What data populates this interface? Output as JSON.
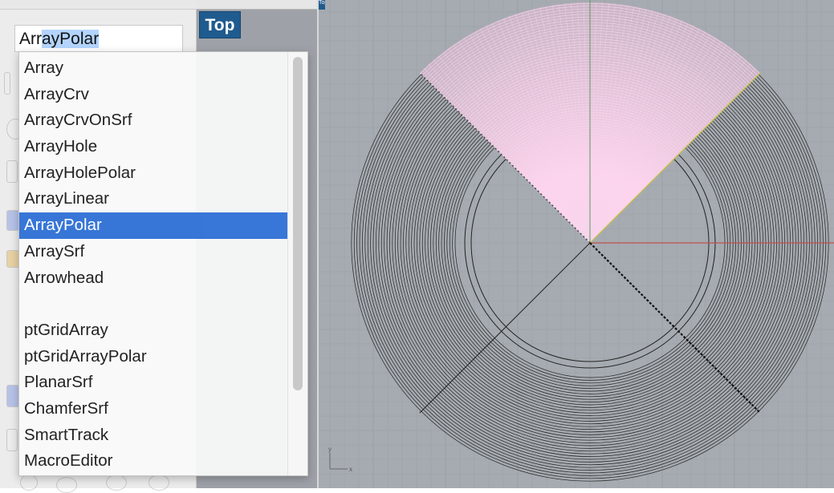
{
  "command_input": {
    "typed": "Arr",
    "autocomplete": "ayPolar"
  },
  "viewport": {
    "label": "Top",
    "tag": "Top",
    "axis_y_label": "y",
    "axis_x_label": "x"
  },
  "dropdown": {
    "items": [
      {
        "label": "Array"
      },
      {
        "label": "ArrayCrv"
      },
      {
        "label": "ArrayCrvOnSrf"
      },
      {
        "label": "ArrayHole"
      },
      {
        "label": "ArrayHolePolar"
      },
      {
        "label": "ArrayLinear"
      },
      {
        "label": "ArrayPolar",
        "selected": true
      },
      {
        "label": "ArraySrf"
      },
      {
        "label": "Arrowhead"
      },
      {
        "separator": true
      },
      {
        "label": "ptGridArray"
      },
      {
        "label": "ptGridArrayPolar"
      },
      {
        "label": "PlanarSrf"
      },
      {
        "label": "ChamferSrf"
      },
      {
        "label": "SmartTrack"
      },
      {
        "label": "MacroEditor"
      }
    ]
  },
  "colors": {
    "selection": "#2d6fd6",
    "viewport_label_bg": "#1f5b8e",
    "x_axis": "#c0504d",
    "y_axis": "#5a9a5a",
    "wedge": "#ffd3ee",
    "viewport_bg": "#a6abb1"
  }
}
